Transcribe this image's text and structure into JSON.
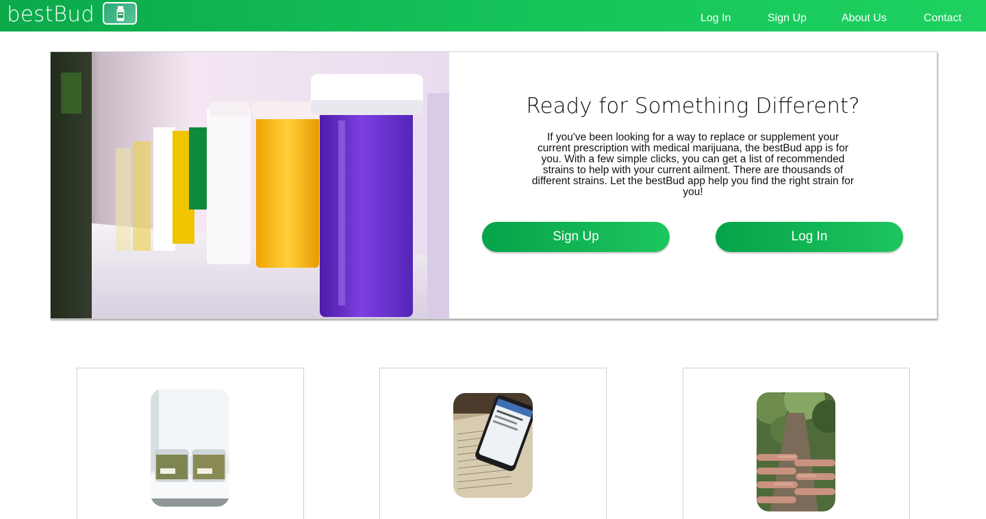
{
  "nav": {
    "brand": "bestBud",
    "brand_icon": "pill-bottle-icon",
    "links": [
      "Log In",
      "Sign Up",
      "About Us",
      "Contact"
    ]
  },
  "hero": {
    "title": "Ready for Something Different?",
    "text": "If you've been looking for a way to replace or supplement your current prescription with medical marijuana, the bestBud app is for you. With a few simple clicks, you can get a list of recommended strains to help with your current ailment. There are thousands of different strains. Let the bestBud app help you find the right strain for you!",
    "signup_label": "Sign Up",
    "login_label": "Log In"
  },
  "colors": {
    "brand_green": "#12b955",
    "text_dark": "#111111",
    "card_border": "#cfcfcf"
  }
}
